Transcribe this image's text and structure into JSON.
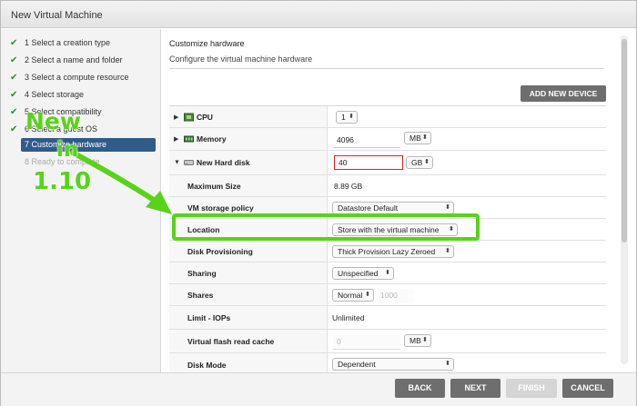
{
  "window": {
    "title": "New Virtual Machine"
  },
  "steps": [
    {
      "label": "1 Select a creation type",
      "state": "done"
    },
    {
      "label": "2 Select a name and folder",
      "state": "done"
    },
    {
      "label": "3 Select a compute resource",
      "state": "done"
    },
    {
      "label": "4 Select storage",
      "state": "done"
    },
    {
      "label": "5 Select compatibility",
      "state": "done"
    },
    {
      "label": "6 Select a guest OS",
      "state": "done"
    },
    {
      "label": "7 Customize hardware",
      "state": "active"
    },
    {
      "label": "8 Ready to complete",
      "state": "disabled"
    }
  ],
  "content": {
    "heading": "Customize hardware",
    "subheading": "Configure the virtual machine hardware",
    "add_device_label": "ADD NEW DEVICE"
  },
  "hardware": {
    "cpu": {
      "label": "CPU",
      "value": "1"
    },
    "memory": {
      "label": "Memory",
      "value": "4096",
      "unit": "MB"
    },
    "disk": {
      "label": "New Hard disk",
      "value": "40",
      "unit": "GB",
      "max_size_label": "Maximum Size",
      "max_size_value": "8.89 GB",
      "policy_label": "VM storage policy",
      "policy_value": "Datastore Default",
      "location_label": "Location",
      "location_value": "Store with the virtual machine",
      "provisioning_label": "Disk Provisioning",
      "provisioning_value": "Thick Provision Lazy Zeroed",
      "sharing_label": "Sharing",
      "sharing_value": "Unspecified",
      "shares_label": "Shares",
      "shares_value": "Normal",
      "shares_number": "1000",
      "limit_label": "Limit - IOPs",
      "limit_value": "Unlimited",
      "flash_label": "Virtual flash read cache",
      "flash_value": "0",
      "flash_unit": "MB",
      "mode_label": "Disk Mode",
      "mode_value": "Dependent"
    }
  },
  "footer": {
    "back": "BACK",
    "next": "NEXT",
    "finish": "FINISH",
    "cancel": "CANCEL"
  },
  "annotation": {
    "line1": "New",
    "line2": "in",
    "line3": "1.10",
    "color": "#58d31a"
  }
}
